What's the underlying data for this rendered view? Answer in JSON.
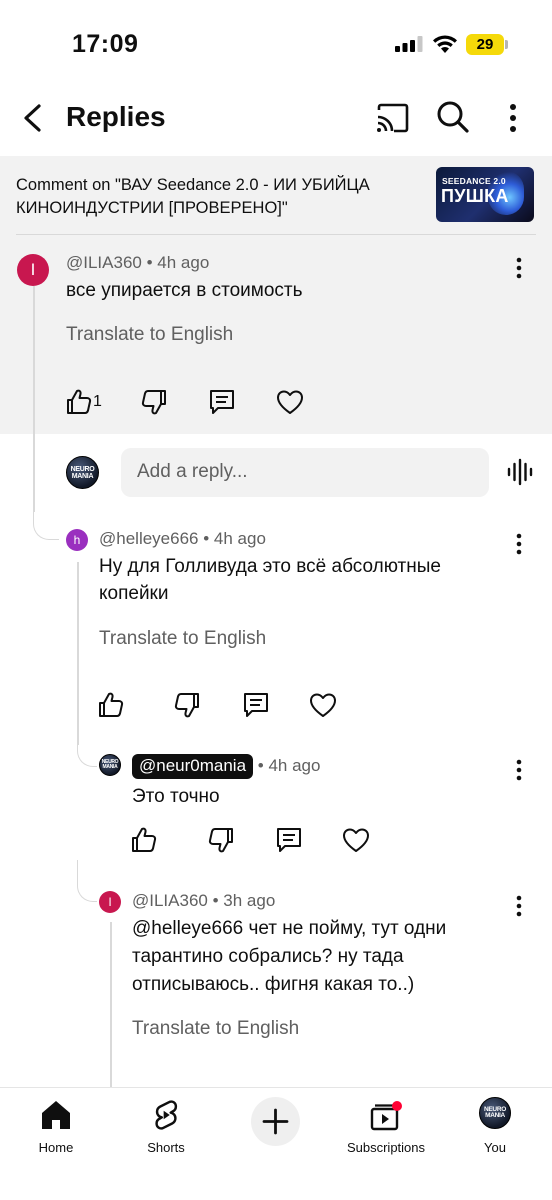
{
  "status_bar": {
    "time": "17:09",
    "battery": "29"
  },
  "header": {
    "title": "Replies"
  },
  "video": {
    "reference": "Comment on \"ВАУ Seedance 2.0 - ИИ УБИЙЦА КИНОИНДУСТРИИ [ПРОВЕРЕНО]\"",
    "thumb_line1": "SEEDANCE 2.0",
    "thumb_line2": "ПУШКА"
  },
  "top_comment": {
    "avatar_letter": "I",
    "author": "@ILIA360",
    "time": "4h ago",
    "text": "все упирается в стоимость",
    "translate": "Translate to English",
    "likes": "1"
  },
  "reply_box": {
    "placeholder": "Add a reply...",
    "avatar_line1": "NEURO",
    "avatar_line2": "MANIA"
  },
  "replies": [
    {
      "avatar_letter": "h",
      "author": "@helleye666",
      "time": "4h ago",
      "text": "Ну для Голливуда это всё абсолютные копейки",
      "translate": "Translate to English"
    },
    {
      "avatar_line1": "NEURO",
      "avatar_line2": "MANIA",
      "author": "@neur0mania",
      "time": "4h ago",
      "text": "Это точно"
    },
    {
      "avatar_letter": "I",
      "author": "@ILIA360",
      "time": "3h ago",
      "text": "@helleye666 чет не пойму, тут одни тарантино собрались? ну тада отписываюсь.. фигня какая то..)",
      "translate": "Translate to English"
    }
  ],
  "meta_separator": "•",
  "bottom_nav": {
    "home": "Home",
    "shorts": "Shorts",
    "subscriptions": "Subscriptions",
    "you": "You",
    "you_avatar_line1": "NEURO",
    "you_avatar_line2": "MANIA"
  },
  "colors": {
    "accent_red": "#ff0033",
    "ilia_avatar": "#c8174f",
    "helleye_avatar": "#9a2fbf",
    "gray_bg": "#f2f2f2"
  }
}
